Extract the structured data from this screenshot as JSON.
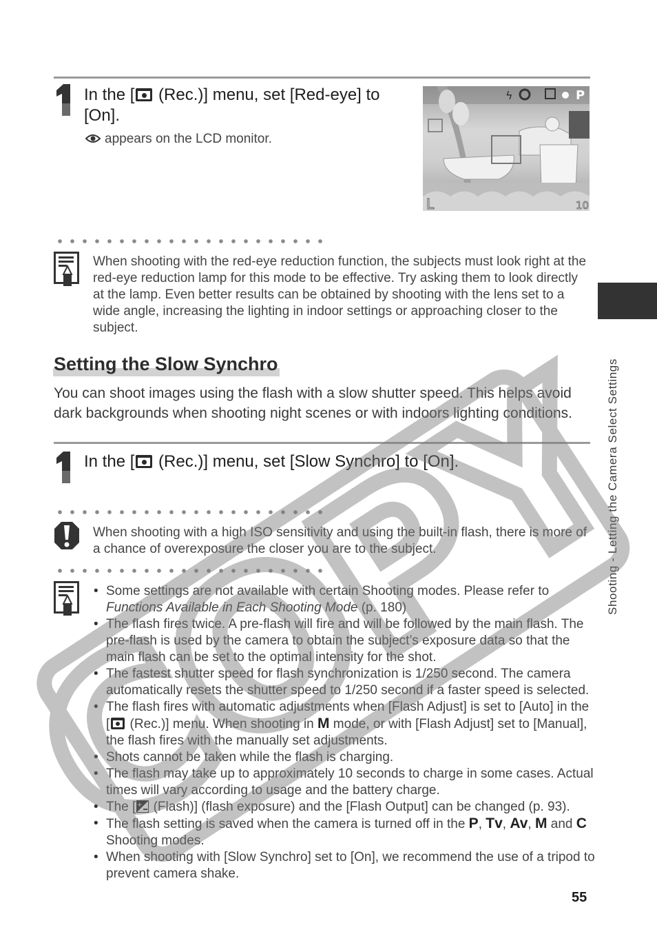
{
  "page": {
    "number": "55",
    "side_tab_label": "Shooting - Letting the Camera Select Settings",
    "watermark": "COPY"
  },
  "step1_redeye": {
    "number": "1",
    "text_before_icon": "In the [",
    "icon": "camera-rec-icon",
    "text_after_icon": " (Rec.)] menu, set [Red-eye] to [On].",
    "subtext_icon": "red-eye-icon",
    "subtext": "appears on the LCD monitor.",
    "lcd_image": {
      "description": "LCD monitor preview showing teapot and tulips",
      "overlay_icons": [
        "flash-icon",
        "red-eye-icon",
        "metering-icon",
        "self-timer-icon"
      ],
      "mode": "P",
      "resolution_icon": "L",
      "shots_remaining": "10"
    }
  },
  "note_redeye": {
    "icon": "note-icon",
    "text": "When shooting with the red-eye reduction function, the subjects must look right at the red-eye reduction lamp for this mode to be effective. Try asking them to look directly at the lamp. Even better results can be obtained by shooting with the lens set to a wide angle, increasing the lighting in indoor settings or approaching closer to the subject."
  },
  "section": {
    "title": "Setting the Slow Synchro",
    "intro": "You can shoot images using the flash with a slow shutter speed. This helps avoid dark backgrounds when shooting night scenes or with indoors lighting conditions."
  },
  "step1_slowsynchro": {
    "number": "1",
    "text_before_icon": "In the [",
    "icon": "camera-rec-icon",
    "text_after_icon": " (Rec.)] menu, set [Slow Synchro] to [On]."
  },
  "caution": {
    "icon": "caution-icon",
    "text": "When shooting with a high ISO sensitivity and using the built-in flash, there is more of a chance of overexposure the closer you are to the subject."
  },
  "notes": {
    "icon": "note-icon",
    "bullets": [
      {
        "a": "Some settings are not available with certain Shooting modes.  Please refer to ",
        "italic": "Functions Available in Each Shooting Mode",
        "b": " (p. 180)"
      },
      {
        "a": "The flash fires twice. A pre-flash will fire and will be followed by the main flash. The pre-flash is used by the camera to obtain the subject’s exposure data so that the main flash can be set to the optimal intensity for the shot."
      },
      {
        "a": "The fastest shutter speed for flash synchronization is 1/250 second. The camera automatically resets the shutter speed to 1/250 second if a faster speed is selected."
      },
      {
        "a": "The flash fires with automatic adjustments when [Flash Adjust] is set to [Auto] in the [",
        "b": " (Rec.)] menu. When shooting in ",
        "mode": "M",
        "c": " mode, or with [Flash Adjust] set to [Manual], the flash fires with the manually set adjustments."
      },
      {
        "a": "Shots cannot be taken while the flash is charging."
      },
      {
        "a": "The flash may take up to approximately 10 seconds to charge in some cases. Actual times will vary according to usage and the battery charge."
      },
      {
        "a": "The [",
        "b": " (Flash)] (flash exposure) and the [Flash Output] can be changed (p. 93)."
      },
      {
        "a": "The flash setting is saved when the camera is turned off in the ",
        "modes": [
          "P",
          "Tv",
          "Av",
          "M"
        ],
        "and": " and ",
        "mode_c": "C",
        "b": " Shooting modes."
      },
      {
        "a": "When shooting with [Slow Synchro] set to [On], we recommend the use of a tripod to prevent camera shake."
      }
    ]
  }
}
